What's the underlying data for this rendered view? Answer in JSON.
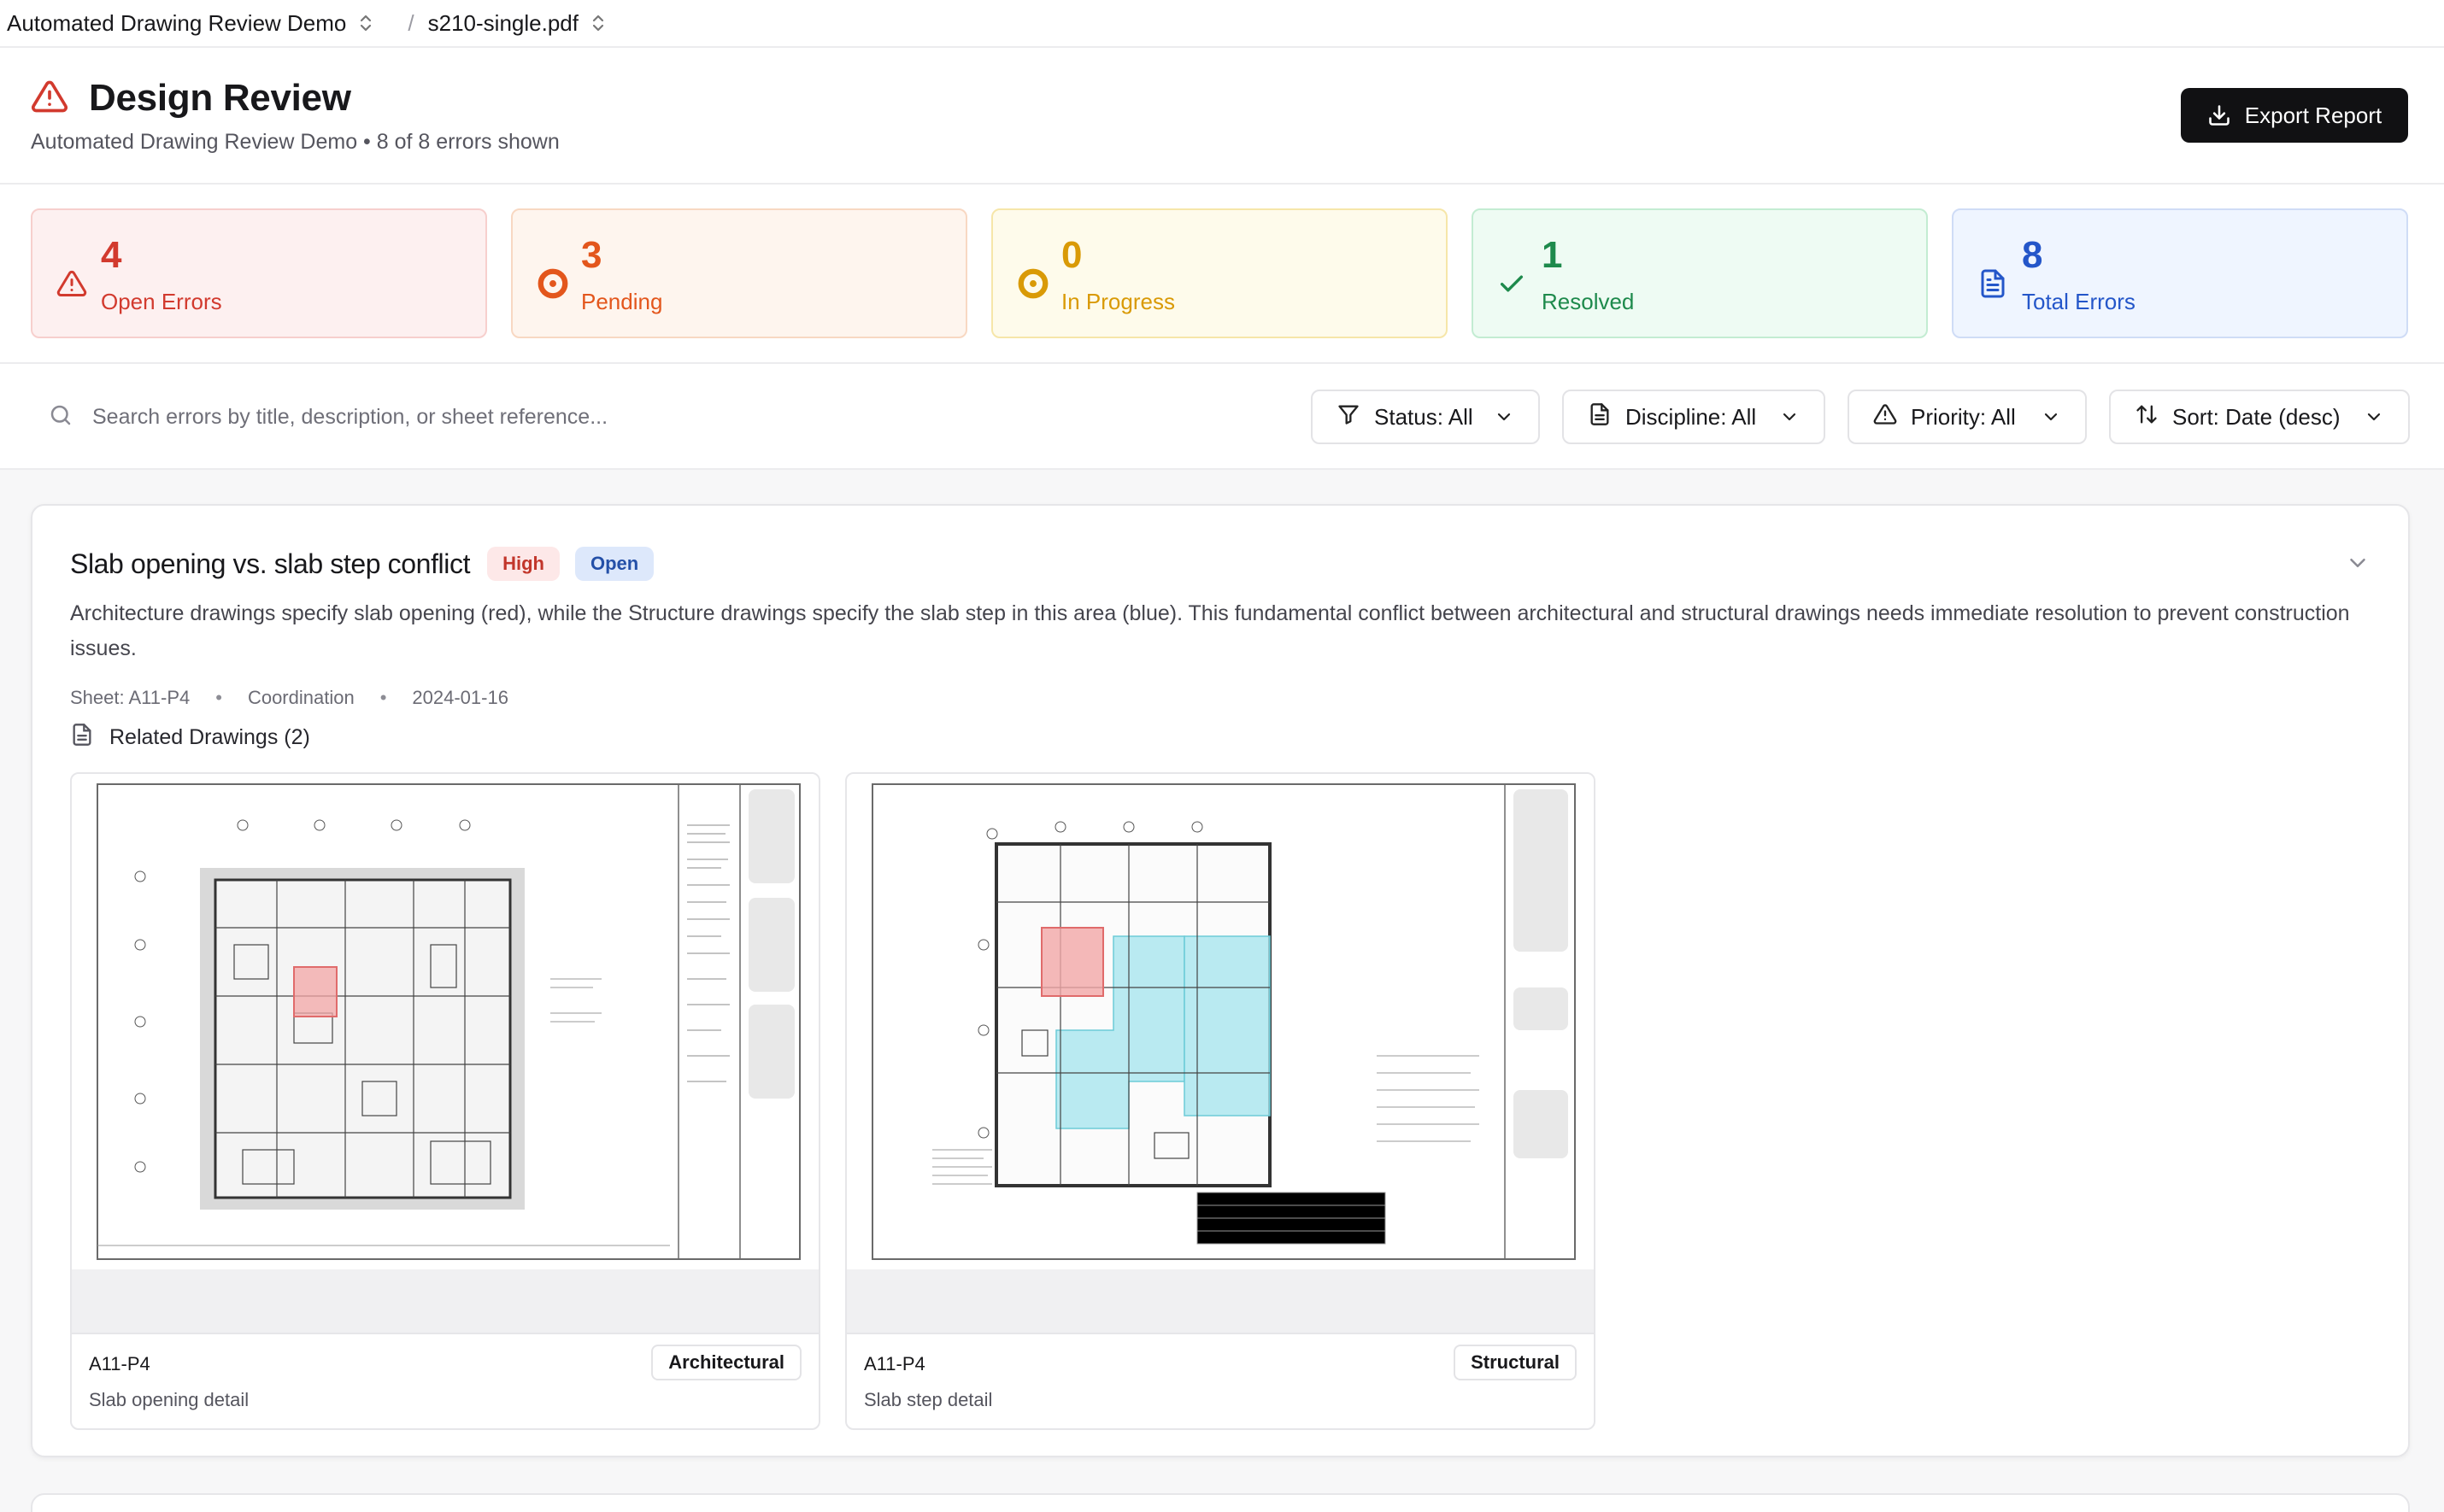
{
  "breadcrumb": {
    "project": "Automated Drawing Review Demo",
    "file": "s210-single.pdf"
  },
  "header": {
    "title": "Design Review",
    "subtitle": "Automated Drawing Review Demo • 8 of 8 errors shown",
    "export_label": "Export Report"
  },
  "stats": [
    {
      "value": "4",
      "label": "Open Errors",
      "icon": "alert-triangle-icon",
      "color": "#d23a2e",
      "bg": "#fdf0f0",
      "border": "#f7cfcd"
    },
    {
      "value": "3",
      "label": "Pending",
      "icon": "circle-dot-icon",
      "color": "#e3561c",
      "bg": "#fef5ee",
      "border": "#f8d8c2"
    },
    {
      "value": "0",
      "label": "In Progress",
      "icon": "circle-dot-icon",
      "color": "#d99a06",
      "bg": "#fefbeb",
      "border": "#f6e6a9"
    },
    {
      "value": "1",
      "label": "Resolved",
      "icon": "check-icon",
      "color": "#1e8a4c",
      "bg": "#eefbf3",
      "border": "#c3ecd2"
    },
    {
      "value": "8",
      "label": "Total Errors",
      "icon": "file-text-icon",
      "color": "#2456c9",
      "bg": "#eff5ff",
      "border": "#cfdcf6"
    }
  ],
  "search": {
    "placeholder": "Search errors by title, description, or sheet reference..."
  },
  "filters": {
    "status": "Status: All",
    "discipline": "Discipline: All",
    "priority": "Priority: All",
    "sort": "Sort: Date (desc)"
  },
  "error_card": {
    "title": "Slab opening vs. slab step conflict",
    "priority": "High",
    "status": "Open",
    "description": "Architecture drawings specify slab opening (red), while the Structure drawings specify the slab step in this area (blue). This fundamental conflict between architectural and structural drawings needs immediate resolution to prevent construction issues.",
    "sheet": "Sheet: A11-P4",
    "category": "Coordination",
    "date": "2024-01-16",
    "related_label": "Related Drawings (2)",
    "drawings": [
      {
        "sheet": "A11-P4",
        "discipline": "Architectural",
        "caption": "Slab opening detail"
      },
      {
        "sheet": "A11-P4",
        "discipline": "Structural",
        "caption": "Slab step detail"
      }
    ]
  },
  "colors": {
    "accent": "#111113",
    "alert": "#d23a2e",
    "highlight_red": "#f3a7a7",
    "highlight_blue": "#a9e6ef"
  }
}
